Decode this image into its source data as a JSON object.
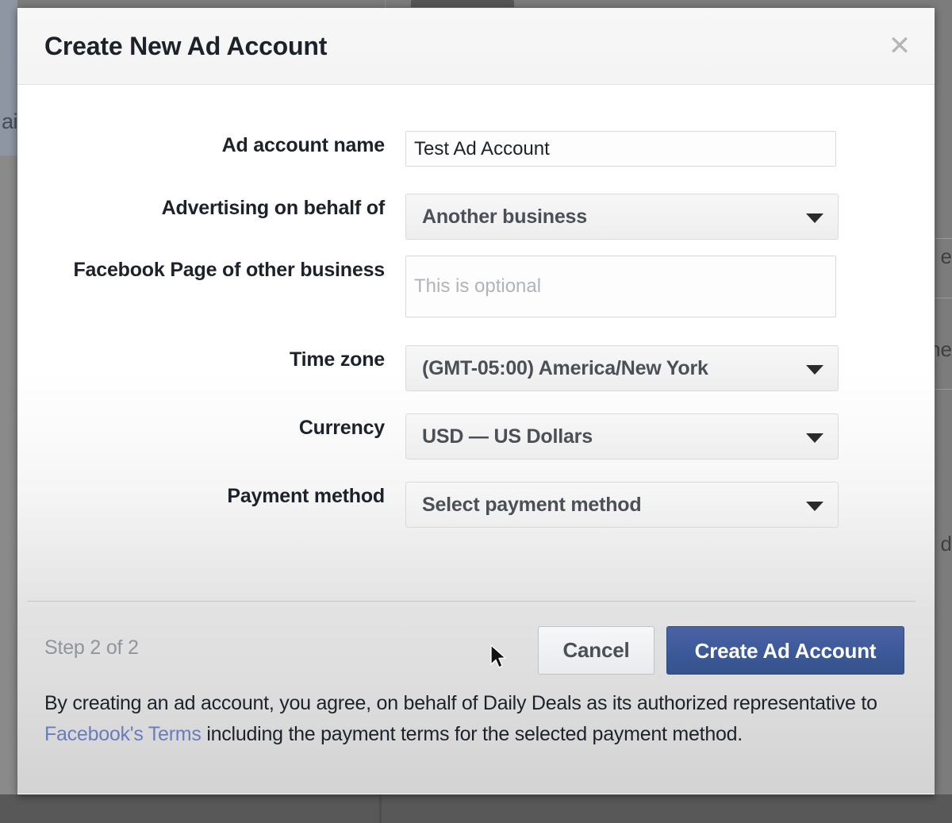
{
  "background": {
    "left_fragment": "ai",
    "right_fragments": [
      "e",
      "ne",
      "d"
    ]
  },
  "modal": {
    "title": "Create New Ad Account",
    "close_icon": "close-icon",
    "close_glyph": "✕",
    "form": {
      "fields": [
        {
          "label": "Ad account name",
          "type": "text",
          "value": "Test Ad Account",
          "placeholder": ""
        },
        {
          "label": "Advertising on behalf of",
          "type": "select",
          "value": "Another business"
        },
        {
          "label": "Facebook Page of other business",
          "type": "text",
          "value": "",
          "placeholder": "This is optional"
        },
        {
          "label": "Time zone",
          "type": "select",
          "value": "(GMT-05:00) America/New York"
        },
        {
          "label": "Currency",
          "type": "select",
          "value": "USD — US Dollars"
        },
        {
          "label": "Payment method",
          "type": "select",
          "value": "Select payment method"
        }
      ]
    },
    "footer": {
      "step_text": "Step 2 of 2",
      "cancel_label": "Cancel",
      "submit_label": "Create Ad Account",
      "legal": {
        "part1": "By creating an ad account, you agree, on behalf of Daily Deals as its authorized representative to ",
        "link": "Facebook's Terms",
        "part2": " including the payment terms for the selected payment method."
      }
    }
  },
  "colors": {
    "primary_button": "#3b5998",
    "link": "#6a7dbb",
    "label_text": "#1d2129",
    "muted_text": "#90949c",
    "select_text": "#4b4f56",
    "placeholder": "#b0b3b8"
  }
}
